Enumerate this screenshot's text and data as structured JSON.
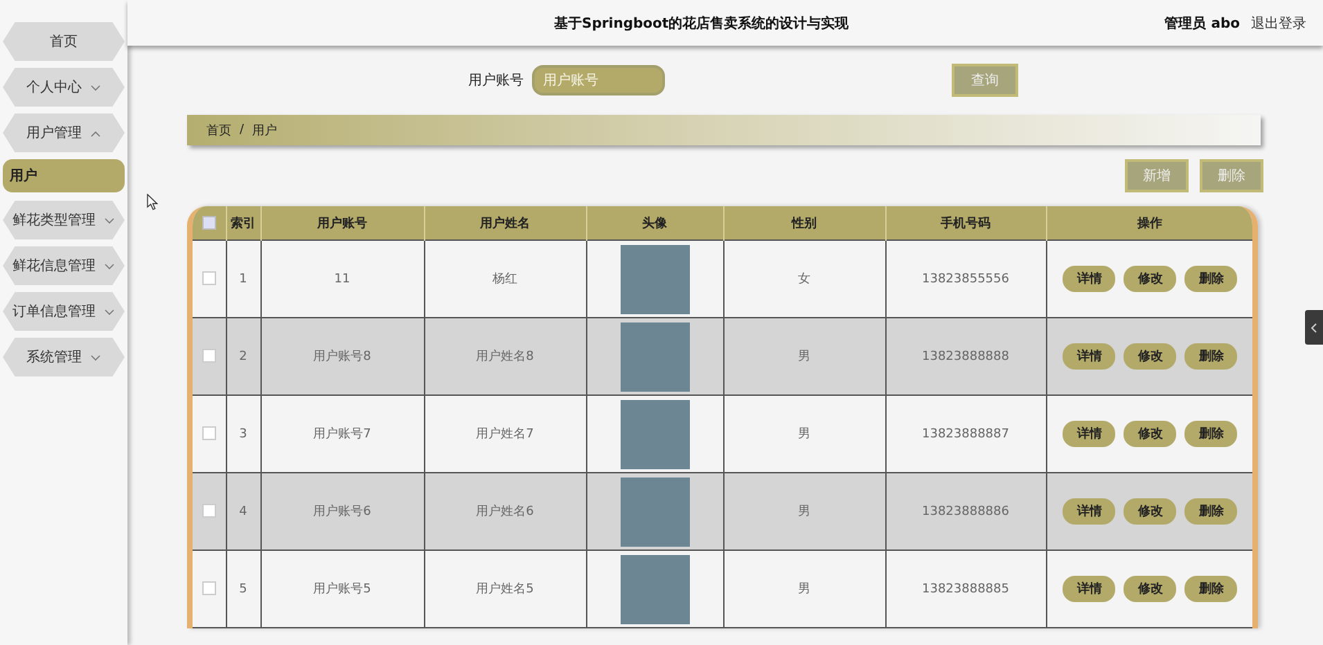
{
  "sidebar": {
    "items": [
      {
        "label": "首页"
      },
      {
        "label": "个人中心",
        "expanded": false
      },
      {
        "label": "用户管理",
        "expanded": true,
        "children": [
          {
            "label": "用户",
            "selected": true
          }
        ]
      },
      {
        "label": "鲜花类型管理",
        "expanded": false
      },
      {
        "label": "鲜花信息管理",
        "expanded": false
      },
      {
        "label": "订单信息管理",
        "expanded": false
      },
      {
        "label": "系统管理",
        "expanded": false
      }
    ]
  },
  "header": {
    "title": "基于Springboot的花店售卖系统的设计与实现",
    "user": "管理员 abo",
    "logout": "退出登录"
  },
  "search": {
    "label": "用户账号",
    "placeholder": "用户账号",
    "button": "查询"
  },
  "breadcrumb": {
    "items": [
      "首页",
      "用户"
    ],
    "separator": "/"
  },
  "toolbar": {
    "buttons": [
      "新增",
      "删除"
    ]
  },
  "table": {
    "select_all_checked": false,
    "columns": [
      "索引",
      "用户账号",
      "用户姓名",
      "头像",
      "性别",
      "手机号码",
      "操作"
    ],
    "rows": [
      {
        "checked": false,
        "index": "1",
        "account": "11",
        "name": "杨红",
        "gender": "女",
        "phone": "13823855556",
        "actions": [
          "详情",
          "修改",
          "删除"
        ]
      },
      {
        "checked": false,
        "index": "2",
        "account": "用户账号8",
        "name": "用户姓名8",
        "gender": "男",
        "phone": "13823888888",
        "actions": [
          "详情",
          "修改",
          "删除"
        ]
      },
      {
        "checked": false,
        "index": "3",
        "account": "用户账号7",
        "name": "用户姓名7",
        "gender": "男",
        "phone": "13823888887",
        "actions": [
          "详情",
          "修改",
          "删除"
        ]
      },
      {
        "checked": false,
        "index": "4",
        "account": "用户账号6",
        "name": "用户姓名6",
        "gender": "男",
        "phone": "13823888886",
        "actions": [
          "详情",
          "修改",
          "删除"
        ]
      },
      {
        "checked": false,
        "index": "5",
        "account": "用户账号5",
        "name": "用户姓名5",
        "gender": "男",
        "phone": "13823888885",
        "actions": [
          "详情",
          "修改",
          "删除"
        ]
      }
    ]
  }
}
